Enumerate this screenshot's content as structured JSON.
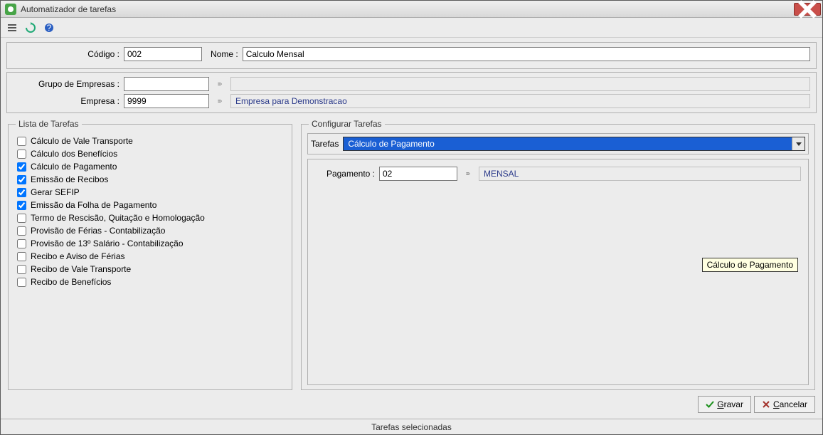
{
  "window": {
    "title": "Automatizador de tarefas"
  },
  "top": {
    "codigo_label": "Código :",
    "codigo_value": "002",
    "nome_label": "Nome :",
    "nome_value": "Calculo Mensal"
  },
  "empresa": {
    "grupo_label": "Grupo de Empresas :",
    "grupo_value": "",
    "empresa_label": "Empresa :",
    "empresa_value": "9999",
    "empresa_desc": "Empresa para Demonstracao"
  },
  "lista": {
    "legend": "Lista de Tarefas",
    "items": [
      {
        "label": "Cálculo de Vale Transporte",
        "checked": false
      },
      {
        "label": "Cálculo dos Benefícios",
        "checked": false
      },
      {
        "label": "Cálculo de Pagamento",
        "checked": true
      },
      {
        "label": "Emissão de Recibos",
        "checked": true
      },
      {
        "label": "Gerar SEFIP",
        "checked": true
      },
      {
        "label": "Emissão da Folha de Pagamento",
        "checked": true
      },
      {
        "label": "Termo de Rescisão, Quitação e Homologação",
        "checked": false
      },
      {
        "label": "Provisão de Férias - Contabilização",
        "checked": false
      },
      {
        "label": "Provisão de 13º Salário - Contabilização",
        "checked": false
      },
      {
        "label": "Recibo e Aviso de Férias",
        "checked": false
      },
      {
        "label": "Recibo de Vale Transporte",
        "checked": false
      },
      {
        "label": "Recibo de Benefícios",
        "checked": false
      }
    ]
  },
  "config": {
    "legend": "Configurar Tarefas",
    "tarefas_label": "Tarefas",
    "tarefas_value": "Cálculo de Pagamento",
    "pagamento_label": "Pagamento :",
    "pagamento_value": "02",
    "pagamento_desc": "MENSAL",
    "tooltip": "Cálculo de Pagamento"
  },
  "buttons": {
    "gravar": "Gravar",
    "cancelar": "Cancelar"
  },
  "status": "Tarefas selecionadas"
}
